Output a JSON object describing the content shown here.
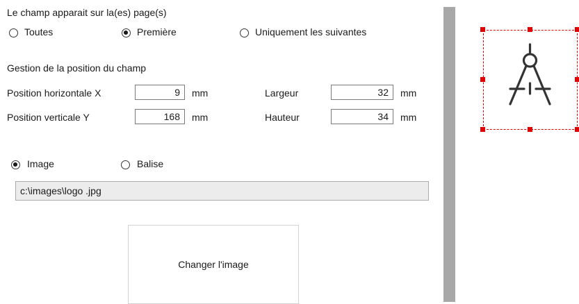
{
  "pages": {
    "title": "Le champ apparait sur la(es) page(s)",
    "options": [
      {
        "label": "Toutes",
        "checked": false
      },
      {
        "label": "Première",
        "checked": true
      },
      {
        "label": "Uniquement les suivantes",
        "checked": false
      }
    ]
  },
  "position": {
    "title": "Gestion de la position du champ",
    "x_label": "Position horizontale X",
    "x_value": "9",
    "y_label": "Position verticale Y",
    "y_value": "168",
    "width_label": "Largeur",
    "width_value": "32",
    "height_label": "Hauteur",
    "height_value": "34",
    "unit": "mm"
  },
  "source": {
    "options": [
      {
        "label": "Image",
        "checked": true
      },
      {
        "label": "Balise",
        "checked": false
      }
    ],
    "path": "c:\\images\\logo .jpg"
  },
  "change_button_label": "Changer l'image",
  "preview": {
    "icon": "drafting-compass-icon",
    "selection_color": "#e00000"
  }
}
